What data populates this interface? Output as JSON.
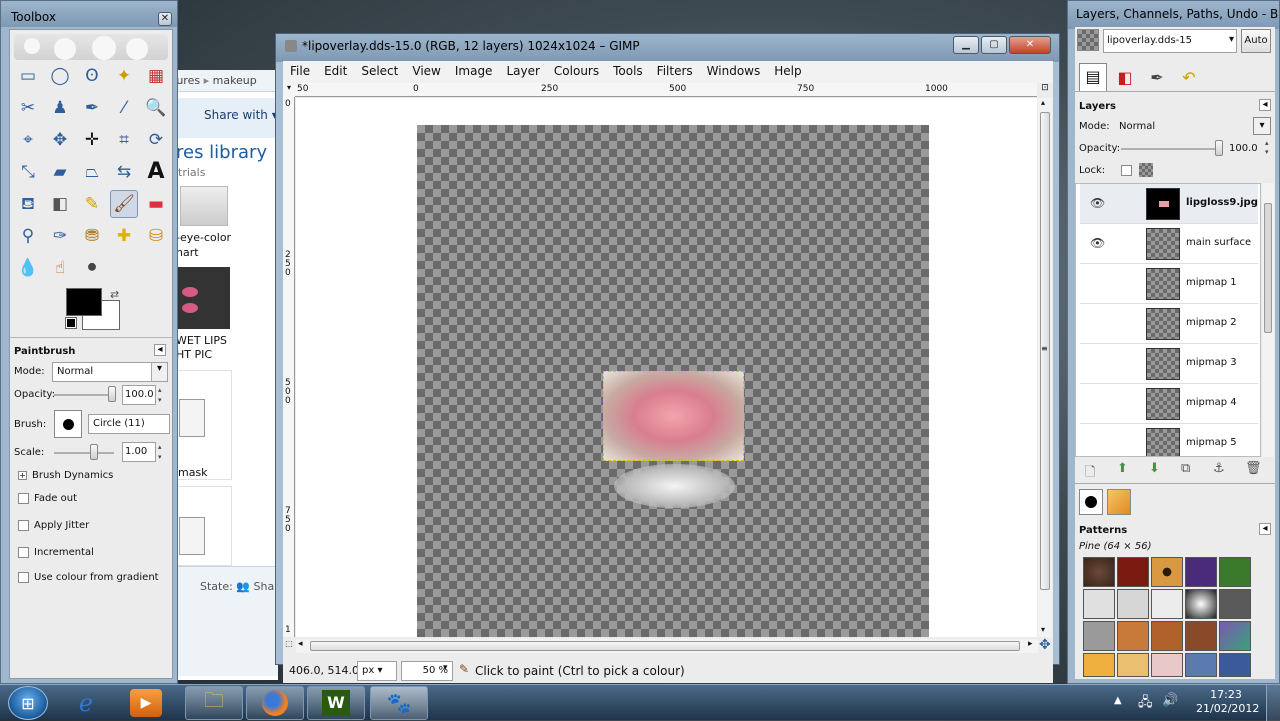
{
  "toolbox": {
    "title": "Toolbox",
    "options_title": "Paintbrush",
    "mode_label": "Mode:",
    "mode_value": "Normal",
    "opacity_label": "Opacity:",
    "opacity_value": "100.0",
    "brush_label": "Brush:",
    "brush_value": "Circle (11)",
    "scale_label": "Scale:",
    "scale_value": "1.00",
    "dynamics_label": "Brush Dynamics",
    "fade_label": "Fade out",
    "jitter_label": "Apply Jitter",
    "incremental_label": "Incremental",
    "gradient_label": "Use colour from gradient"
  },
  "explorer": {
    "breadcrumb_1": "tures",
    "breadcrumb_2": "makeup",
    "share_with": "Share with",
    "library_title": "res library",
    "library_sub": "trials",
    "item1_l1": "-eye-color",
    "item1_l2": "hart",
    "item2_l1": "WET LIPS",
    "item2_l2": "HT PIC",
    "item3": "mask",
    "state_label": "State:",
    "state_value": "Sha"
  },
  "image_window": {
    "title": "*lipoverlay.dds-15.0 (RGB, 12 layers) 1024x1024 – GIMP",
    "menu": [
      "File",
      "Edit",
      "Select",
      "View",
      "Image",
      "Layer",
      "Colours",
      "Tools",
      "Filters",
      "Windows",
      "Help"
    ],
    "ruler_h": [
      "50",
      "0",
      "250",
      "500",
      "750",
      "1000"
    ],
    "ruler_v": [
      "0",
      "2 5 0",
      "5 0 0",
      "7 5 0",
      "1"
    ],
    "coords": "406.0, 514.0",
    "unit": "px",
    "zoom": "50 %",
    "status": "Click to paint (Ctrl to pick a colour)"
  },
  "dock": {
    "title": "Layers, Channels, Paths, Undo - B...",
    "image_select": "lipoverlay.dds-15",
    "auto": "Auto",
    "layers_title": "Layers",
    "mode_label": "Mode:",
    "mode_value": "Normal",
    "opacity_label": "Opacity:",
    "opacity_value": "100.0",
    "lock_label": "Lock:",
    "layers": [
      "lipgloss9.jpg",
      "main surface",
      "mipmap 1",
      "mipmap 2",
      "mipmap 3",
      "mipmap 4",
      "mipmap 5"
    ],
    "patterns_title": "Patterns",
    "pattern_name": "Pine (64 × 56)"
  },
  "taskbar": {
    "time": "17:23",
    "date": "21/02/2012",
    "wps_letter": "W"
  },
  "colors": {
    "accent": "#2f5f9a",
    "titlebar": "#9fb6cc",
    "fg_color": "#000000",
    "bg_color": "#ffffff"
  }
}
